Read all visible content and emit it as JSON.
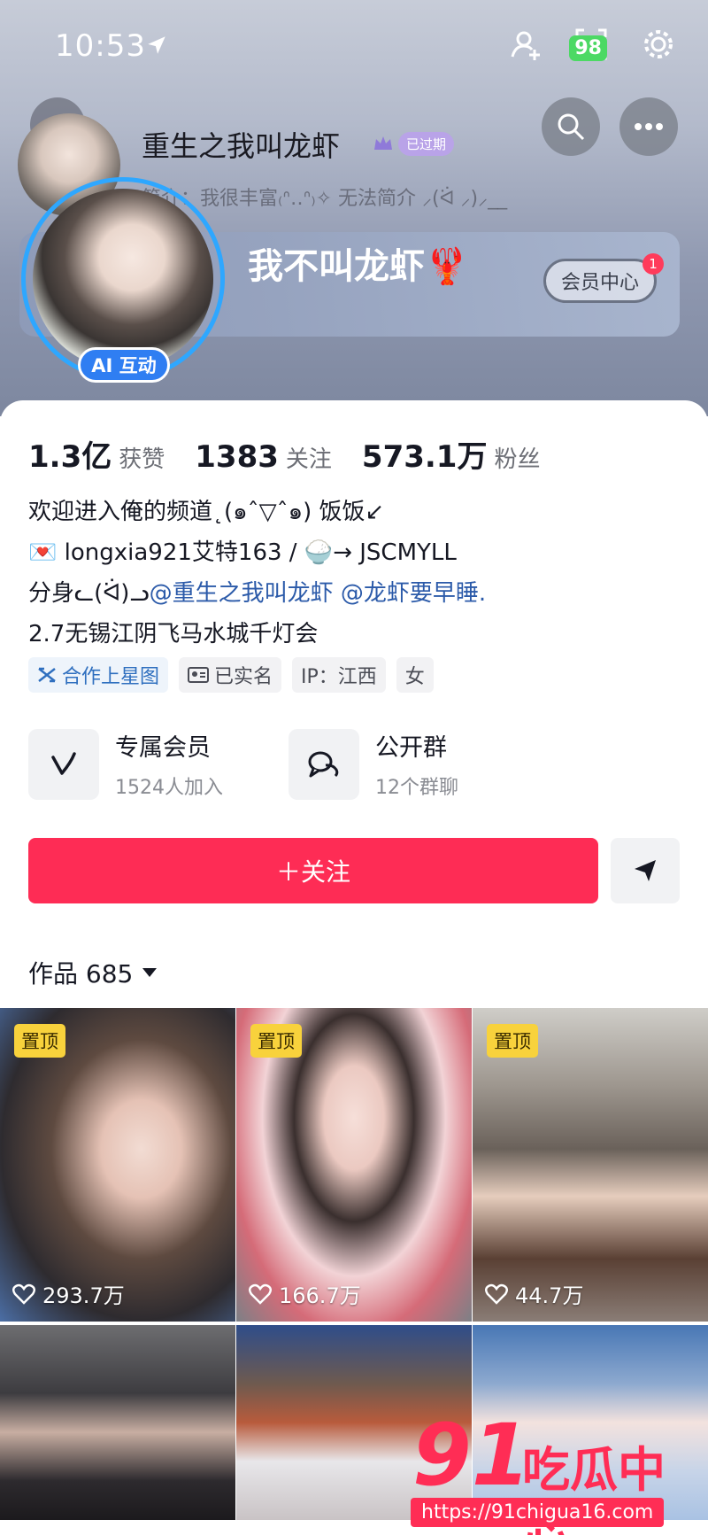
{
  "status_bar": {
    "time": "10:53",
    "battery": "98"
  },
  "header": {
    "nickname": "重生之我叫龙虾",
    "expired_badge": "已过期",
    "intro": "简介：我很丰富₍ᐢ‥ᐢ₎✧ 无法简介 ⸝(ᐛ ⸝)⸝__",
    "banner_title": "我不叫龙虾🦞",
    "vip_center": "会员中心",
    "vip_count": "1",
    "ai_badge": "AI 互动"
  },
  "stats": [
    {
      "value": "1.3亿",
      "label": "获赞"
    },
    {
      "value": "1383",
      "label": "关注"
    },
    {
      "value": "573.1万",
      "label": "粉丝"
    }
  ],
  "bio": {
    "line1": "欢迎进入俺的频道˛(๑ˆ▽ˆ๑) 饭饭↙",
    "line2": "💌 longxia921艾特163  /  🍚→  JSCMYLL",
    "line3_prefix": "分身ᓚ(ᐛ)ᓗ",
    "mention1": "@重生之我叫龙虾",
    "mention2": "@龙虾要早睡.",
    "line4": "2.7无锡江阴飞马水城千灯会"
  },
  "tags": [
    {
      "label": "合作上星图"
    },
    {
      "label": "已实名"
    },
    {
      "label": "IP：江西"
    },
    {
      "label": "女"
    }
  ],
  "features": [
    {
      "title": "专属会员",
      "sub": "1524人加入"
    },
    {
      "title": "公开群",
      "sub": "12个群聊"
    }
  ],
  "actions": {
    "follow": "＋关注"
  },
  "works": {
    "title": "作品 685"
  },
  "grid": [
    {
      "pin": "置顶",
      "likes": "293.7万"
    },
    {
      "pin": "置顶",
      "likes": "166.7万"
    },
    {
      "pin": "置顶",
      "likes": "44.7万"
    }
  ],
  "watermark": {
    "number": "91",
    "text": "吃瓜中心",
    "url": "https://91chigua16.com"
  }
}
